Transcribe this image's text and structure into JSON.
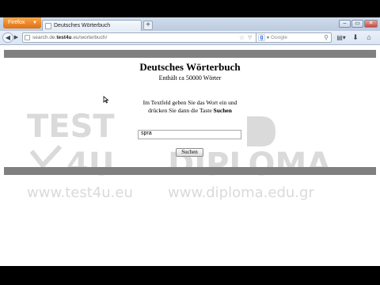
{
  "browser": {
    "menu_button_label": "Firefox",
    "tab_title": "Deutsches Wörterbuch",
    "new_tab_label": "+",
    "url_host_prefix": "search.de.",
    "url_host_bold": "test4u",
    "url_rest": ".eu/worterbuch/",
    "search_engine_placeholder": "Google",
    "icons": [
      "back-arrow-icon",
      "forward-arrow-icon",
      "star-icon",
      "reload-icon",
      "google-icon",
      "magnifier-icon",
      "bookmarks-icon",
      "download-icon",
      "home-icon"
    ]
  },
  "page": {
    "title": "Deutsches Wörterbuch",
    "subtitle": "Enthält ca 50000 Wörter",
    "instruction_line1": "Im Textfeld geben Sie das Wort ein und",
    "instruction_line2_prefix": "drücken Sie dann die Taste ",
    "instruction_line2_bold": "Suchen",
    "input_value": "spra",
    "search_button_label": "Suchen"
  },
  "watermark": {
    "brand": "TEST4U",
    "brand_url": "www.test4u.eu",
    "diploma": "DIPLOMA",
    "diploma_url": "www.diploma.edu.gr"
  },
  "colors": {
    "firefox_orange": "#e66000",
    "page_bar": "#808080",
    "watermark": "#d8d8d8"
  }
}
